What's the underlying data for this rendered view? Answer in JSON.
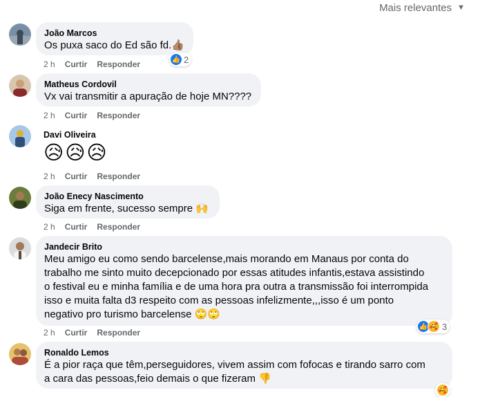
{
  "sort": {
    "label": "Mais relevantes"
  },
  "actions": {
    "like": "Curtir",
    "reply": "Responder"
  },
  "comments": [
    {
      "author": "João Marcos",
      "text": "Os puxa saco do Ed são fd.👍🏽",
      "time": "2 h",
      "reaction_count": "2",
      "avatar_colors": [
        "#7a8fa6",
        "#3d4a57"
      ]
    },
    {
      "author": "Matheus Cordovil",
      "text": "Vx vai transmitir a apuração de hoje MN????",
      "time": "2 h",
      "avatar_colors": [
        "#c9a07a",
        "#8a2b2b"
      ]
    },
    {
      "author": "Davi Oliveira",
      "text": "😥😥😥",
      "time": "2 h",
      "avatar_colors": [
        "#a7c7e7",
        "#e0b030"
      ]
    },
    {
      "author": "João Enecy Nascimento",
      "text": "Siga em frente, sucesso sempre 🙌",
      "time": "2 h",
      "avatar_colors": [
        "#6b7d3a",
        "#2f3d1c"
      ]
    },
    {
      "author": "Jandecir Brito",
      "text": "Meu amigo eu como sendo barcelense,mais morando em Manaus por conta do\ntrabalho me sinto muito decepcionado por essas atitudes infantis,estava assistindo\no festival eu e minha família e de uma hora pra outra a transmissão foi interrompida\nisso e muita falta d3 respeito com as pessoas infelizmente,,,isso é um ponto\nnegativo pro turismo barcelense 🙄🙄",
      "time": "2 h",
      "reaction_count": "3",
      "avatar_colors": [
        "#dcdcdc",
        "#5a4a3a"
      ]
    },
    {
      "author": "Ronaldo Lemos",
      "text": "É a pior raça que têm,perseguidores, vivem assim com fofocas e tirando sarro com\na cara das pessoas,feio demais o que fizeram 👎",
      "time": "2 h",
      "avatar_colors": [
        "#e6c36a",
        "#b04a3a"
      ]
    }
  ],
  "icons": {
    "like": "thumbs-up-icon",
    "care": "care-icon",
    "caret": "caret-down-icon"
  }
}
